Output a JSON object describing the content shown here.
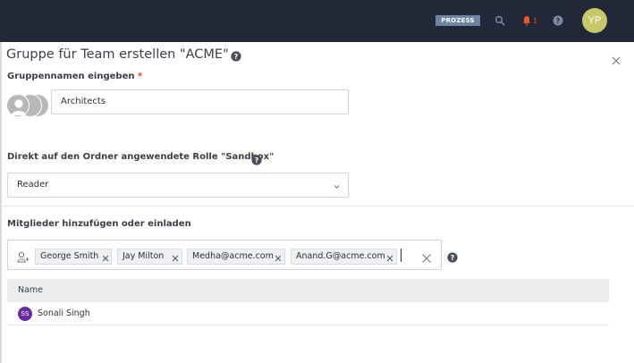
{
  "topbar": {
    "badge_label": "PROZESS",
    "notification_count": "1",
    "user_initials": "YP",
    "icons": [
      "search-icon",
      "bell-icon",
      "help-icon"
    ],
    "colors": {
      "bar": "#232838",
      "badge": "#6d85a3",
      "bell": "#e8562a",
      "avatar": "#c6c86a"
    }
  },
  "dialog": {
    "title": "Gruppe für Team erstellen \"ACME\"",
    "group_name": {
      "label": "Gruppennamen eingeben",
      "required_marker": "*",
      "value": "Architects"
    },
    "role": {
      "label": "Direkt auf den Ordner angewendete Rolle \"Sandbox\"",
      "selected": "Reader"
    },
    "members": {
      "label": "Mitglieder hinzufügen oder einladen",
      "chips": [
        "George Smith",
        "Jay Milton",
        "Medha@acme.com",
        "Anand.G@acme.com"
      ],
      "table": {
        "header": "Name",
        "rows": [
          {
            "initials": "SS",
            "name": "Sonali Singh"
          }
        ]
      }
    }
  }
}
